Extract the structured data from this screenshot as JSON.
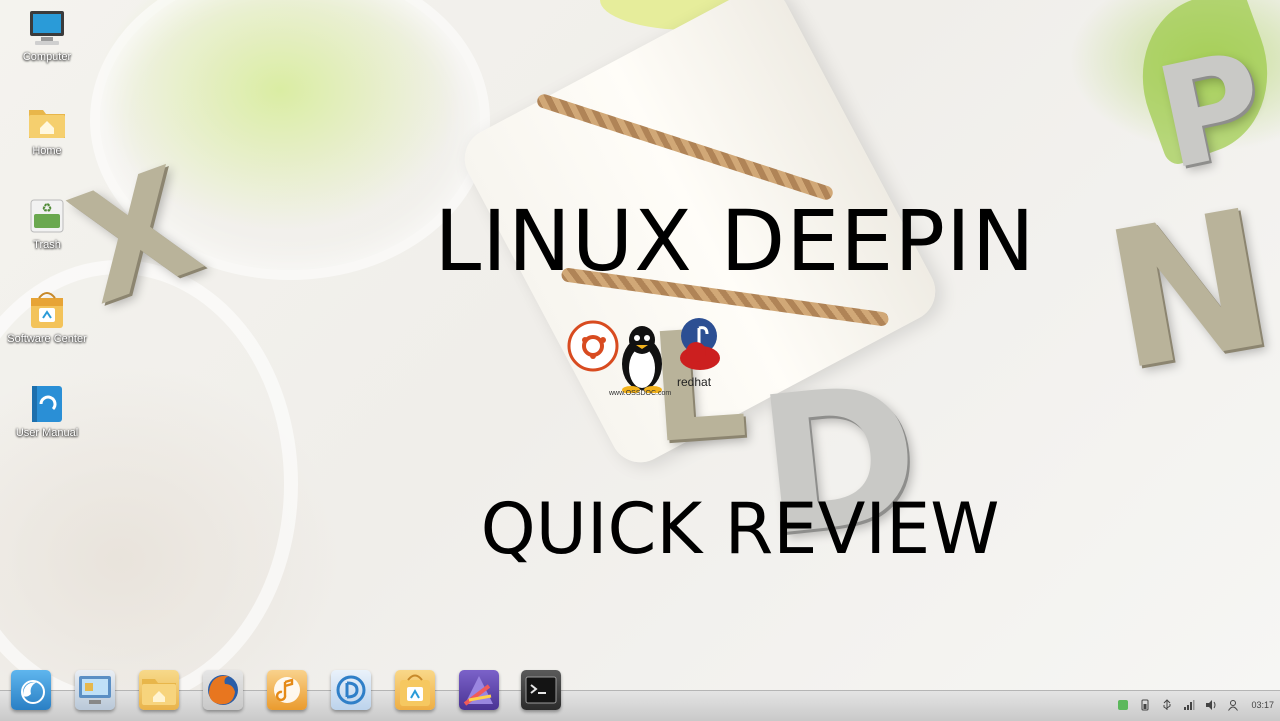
{
  "desktop": {
    "icons": [
      {
        "label": "Computer"
      },
      {
        "label": "Home"
      },
      {
        "label": "Trash"
      },
      {
        "label": "Software Center"
      },
      {
        "label": "User Manual"
      }
    ]
  },
  "overlay": {
    "title": "LINUX DEEPIN",
    "subtitle": "QUICK REVIEW",
    "logos_caption": "www.OSSDOC.com",
    "redhat_text": "redhat"
  },
  "taskbar": {
    "apps": [
      {
        "icon": "deepin-launcher-icon"
      },
      {
        "icon": "desktop-settings-icon"
      },
      {
        "icon": "file-manager-icon"
      },
      {
        "icon": "firefox-icon"
      },
      {
        "icon": "deepin-music-icon"
      },
      {
        "icon": "deepin-movie-icon"
      },
      {
        "icon": "software-center-icon"
      },
      {
        "icon": "app-store-icon"
      },
      {
        "icon": "terminal-icon"
      }
    ],
    "tray": {
      "clock": "03:17"
    }
  },
  "colors": {
    "accent": "#3a95d8",
    "taskbar_bg": "#d6d6d6",
    "text": "#000000"
  }
}
